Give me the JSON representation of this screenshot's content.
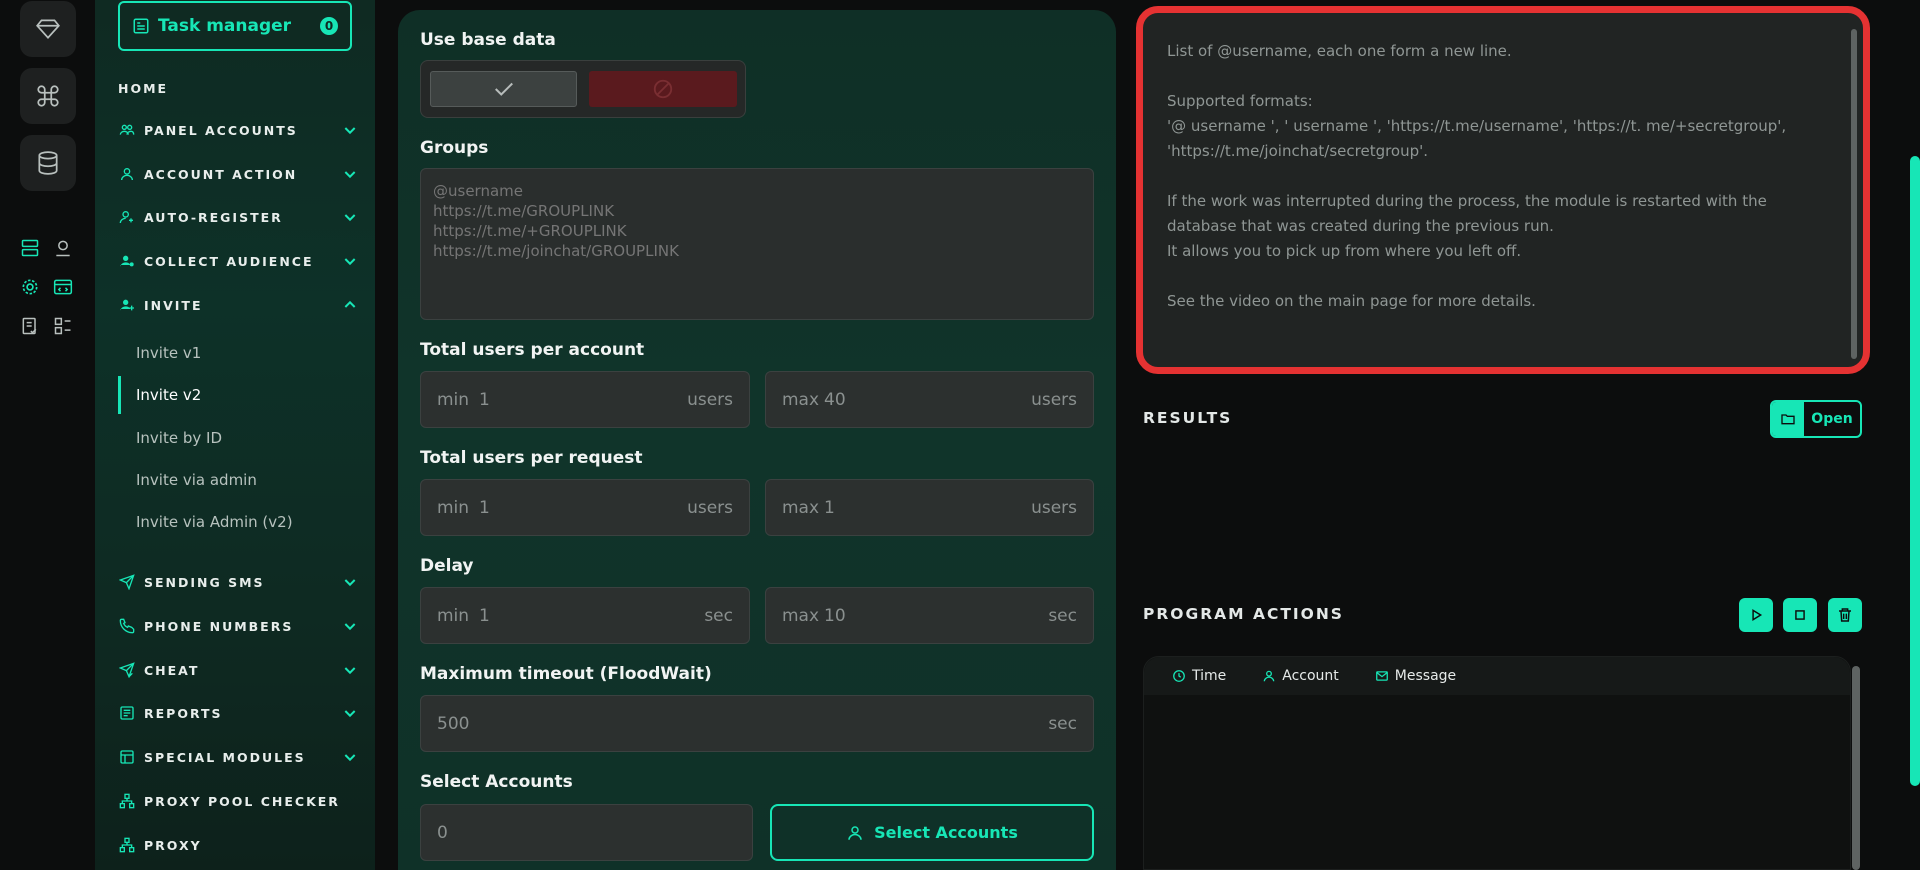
{
  "sidebar": {
    "task_manager": {
      "label": "Task manager",
      "badge": "0"
    },
    "items": [
      {
        "label": "HOME",
        "icon": "home"
      },
      {
        "label": "PANEL ACCOUNTS",
        "icon": "users-icon"
      },
      {
        "label": "ACCOUNT ACTION",
        "icon": "user-icon"
      },
      {
        "label": "AUTO-REGISTER",
        "icon": "user-plus-icon"
      },
      {
        "label": "COLLECT AUDIENCE",
        "icon": "user-gear-icon"
      },
      {
        "label": "INVITE",
        "icon": "user-plus-icon"
      },
      {
        "label": "SENDING SMS",
        "icon": "send-icon"
      },
      {
        "label": "PHONE NUMBERS",
        "icon": "phone-icon"
      },
      {
        "label": "CHEAT",
        "icon": "send-check-icon"
      },
      {
        "label": "REPORTS",
        "icon": "report-icon"
      },
      {
        "label": "SPECIAL MODULES",
        "icon": "module-icon"
      },
      {
        "label": "PROXY POOL CHECKER",
        "icon": "network-icon"
      },
      {
        "label": "PROXY",
        "icon": "network-icon"
      }
    ],
    "invite_sub": [
      {
        "label": "Invite v1"
      },
      {
        "label": "Invite v2"
      },
      {
        "label": "Invite by ID"
      },
      {
        "label": "Invite via admin"
      },
      {
        "label": "Invite via Admin (v2)"
      }
    ]
  },
  "form": {
    "use_base_data": {
      "label": "Use base data"
    },
    "groups": {
      "label": "Groups",
      "placeholder": "@username\nhttps://t.me/GROUPLINK\nhttps://t.me/+GROUPLINK\nhttps://t.me/joinchat/GROUPLINK"
    },
    "total_users_per_account": {
      "label": "Total users per account",
      "min": {
        "prefix": "min",
        "value": "1",
        "suffix": "users"
      },
      "max": {
        "prefix": "max",
        "value": "40",
        "suffix": "users"
      }
    },
    "total_users_per_request": {
      "label": "Total users per request",
      "min": {
        "prefix": "min",
        "value": "1",
        "suffix": "users"
      },
      "max": {
        "prefix": "max",
        "value": "1",
        "suffix": "users"
      }
    },
    "delay": {
      "label": "Delay",
      "min": {
        "prefix": "min",
        "value": "1",
        "suffix": "sec"
      },
      "max": {
        "prefix": "max",
        "value": "10",
        "suffix": "sec"
      }
    },
    "max_timeout": {
      "label": "Maximum timeout (FloodWait)",
      "value": "500",
      "suffix": "sec"
    },
    "select_accounts": {
      "label": "Select Accounts",
      "value": "0",
      "button": "Select Accounts"
    }
  },
  "info": {
    "text": "List of @username, each one form a new line.\n\nSupported formats:\n'@ username ', ' username ', 'https://t.me/username', 'https://t. me/+secretgroup', 'https://t.me/joinchat/secretgroup'.\n\nIf the work was interrupted during the process, the module is restarted with the database that was created during the previous run.\nIt allows you to pick up from where you left off.\n\nSee the video on the main page for more details."
  },
  "results": {
    "title": "RESULTS",
    "open_label": "Open"
  },
  "program_actions": {
    "title": "PROGRAM ACTIONS",
    "columns": [
      {
        "label": "Time",
        "icon": "clock-icon"
      },
      {
        "label": "Account",
        "icon": "user-icon"
      },
      {
        "label": "Message",
        "icon": "mail-icon"
      }
    ]
  },
  "colors": {
    "accent": "#17e6b6",
    "highlight": "#e53232",
    "disabled": "#5a1a1e"
  }
}
